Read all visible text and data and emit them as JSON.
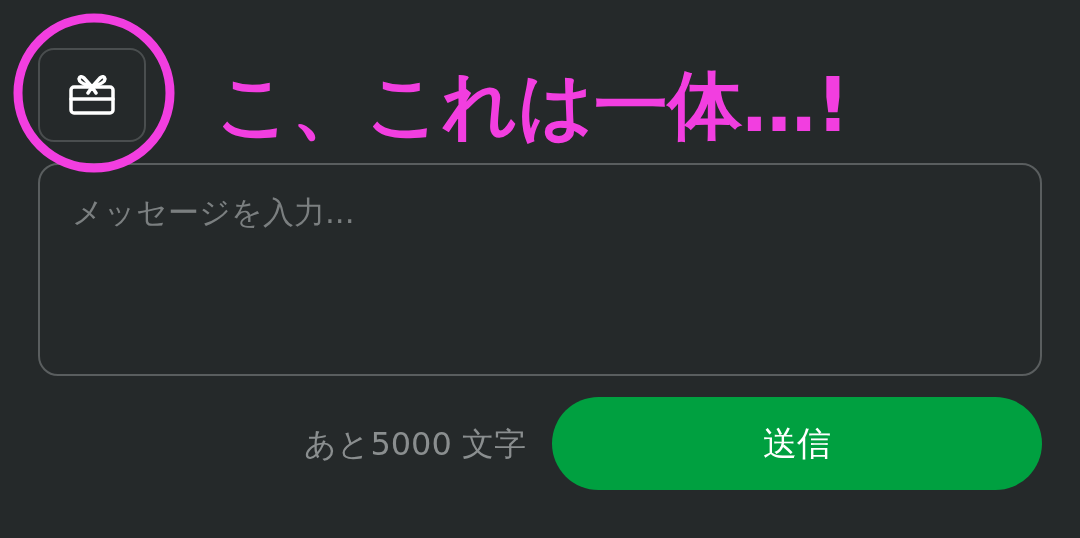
{
  "annotation": {
    "text": "こ、これは一体…!"
  },
  "gift_button": {
    "circled": true
  },
  "message": {
    "placeholder": "メッセージを入力..."
  },
  "counter": "あと5000 文字",
  "send_button": "送信"
}
